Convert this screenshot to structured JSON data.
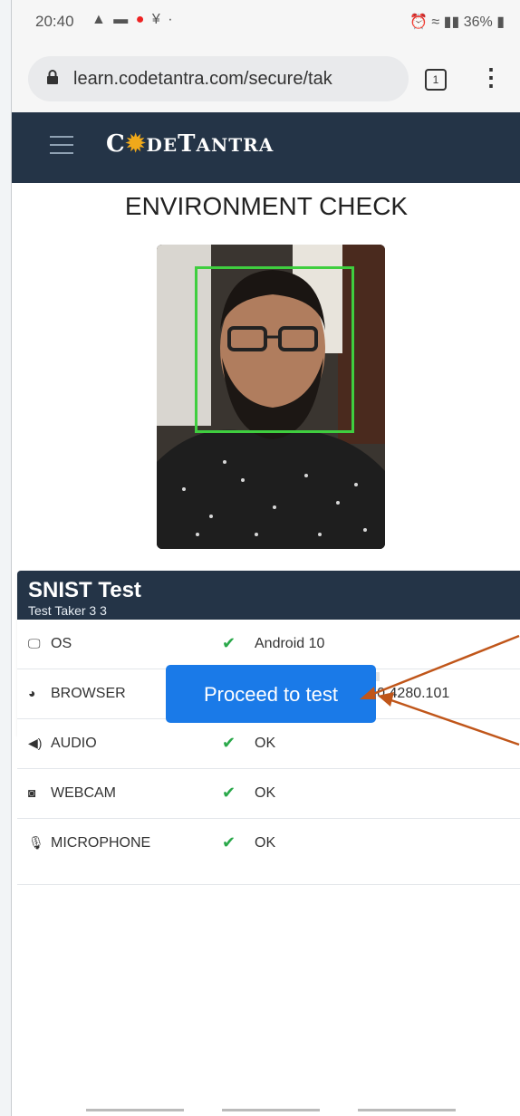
{
  "status_bar": {
    "time": "20:40",
    "icons": [
      "warning-icon",
      "message-icon",
      "jio-icon",
      "wifi-alert-icon",
      "dot-icon"
    ],
    "right_text": "36%",
    "right_icons": [
      "alarm-icon",
      "wifi-icon",
      "signal-icon",
      "signal-icon",
      "battery-icon"
    ]
  },
  "browser": {
    "url": "learn.codetantra.com/secure/tak",
    "tab_count": "1"
  },
  "header": {
    "logo_text_c": "C",
    "logo_text_de": "DE",
    "logo_text_t": "T",
    "logo_text_antra": "ANTRA",
    "colors": {
      "bg": "#243447",
      "gear": "#f0a91a"
    }
  },
  "page": {
    "title": "ENVIRONMENT CHECK"
  },
  "test": {
    "name": "SNIST Test",
    "taker": "Test Taker 3 3"
  },
  "checks": [
    {
      "icon": "monitor-icon",
      "label": "OS",
      "status": "✔",
      "value": "Android 10"
    },
    {
      "icon": "globe-icon",
      "label": "BROWSER",
      "status": "✔",
      "value": "Chrome Mobile 87.0.4280.101"
    },
    {
      "icon": "speaker-icon",
      "label": "AUDIO",
      "status": "✔",
      "value": "OK"
    },
    {
      "icon": "camera-icon",
      "label": "WEBCAM",
      "status": "✔",
      "value": "OK"
    },
    {
      "icon": "microphone-icon",
      "label": "MICROPHONE",
      "status": "✔",
      "value": "OK"
    }
  ],
  "microphone_level": 0,
  "actions": {
    "proceed_label": "Proceed to test",
    "color": "#1a7ae8"
  },
  "annotations": {
    "arrow_color": "#c0561a"
  }
}
